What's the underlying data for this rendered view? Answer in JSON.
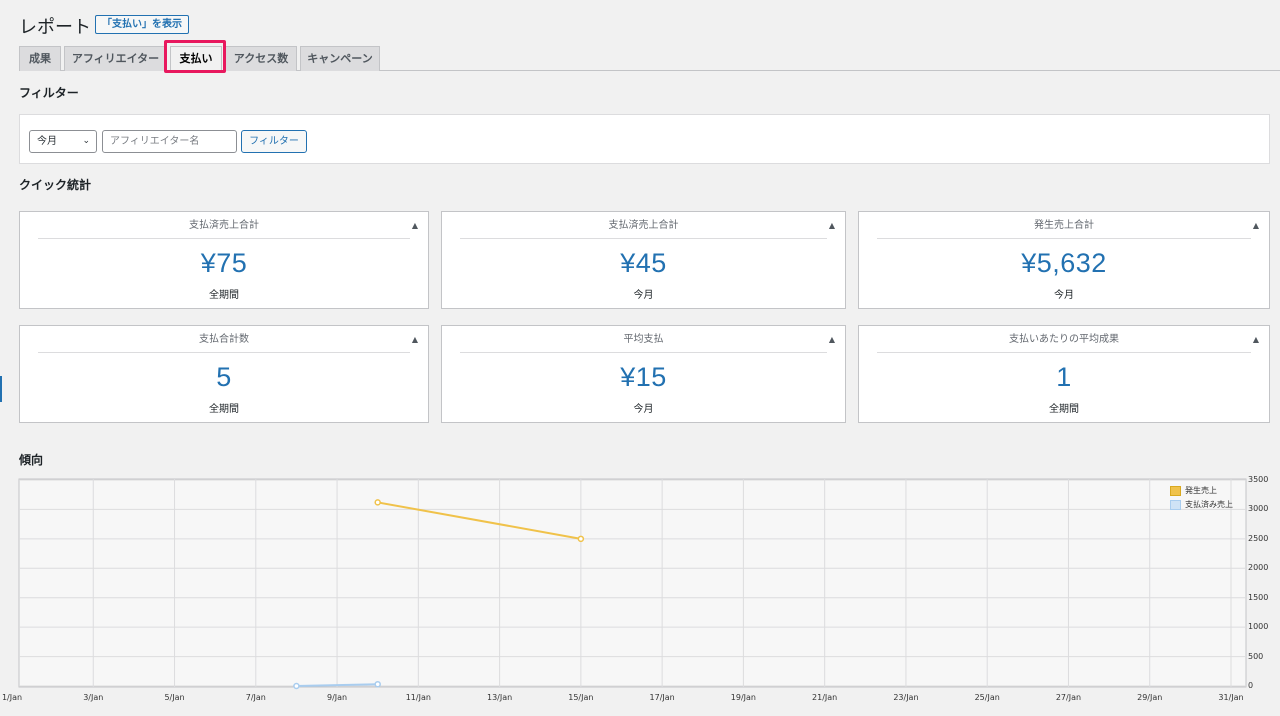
{
  "header": {
    "title": "レポート",
    "show_payouts_button": "「支払い」を表示"
  },
  "tabs": [
    {
      "label": "成果",
      "active": false
    },
    {
      "label": "アフィリエイター",
      "active": false
    },
    {
      "label": "支払い",
      "active": true
    },
    {
      "label": "アクセス数",
      "active": false
    },
    {
      "label": "キャンペーン",
      "active": false
    }
  ],
  "filter": {
    "heading": "フィルター",
    "period_select": "今月",
    "affiliate_placeholder": "アフィリエイター名",
    "filter_button": "フィルター"
  },
  "quick_stats": {
    "heading": "クイック統計",
    "cards": [
      {
        "title": "支払済売上合計",
        "value": "¥75",
        "period": "全期間"
      },
      {
        "title": "支払済売上合計",
        "value": "¥45",
        "period": "今月"
      },
      {
        "title": "発生売上合計",
        "value": "¥5,632",
        "period": "今月"
      },
      {
        "title": "支払合計数",
        "value": "5",
        "period": "全期間"
      },
      {
        "title": "平均支払",
        "value": "¥15",
        "period": "今月"
      },
      {
        "title": "支払いあたりの平均成果",
        "value": "1",
        "period": "全期間"
      }
    ]
  },
  "trend": {
    "heading": "傾向"
  },
  "colors": {
    "accent": "#2271b1",
    "highlight": "#e8185e",
    "series_generated": "#f0c24a",
    "series_paid": "#a9cdef"
  },
  "chart_data": {
    "type": "line",
    "x_ticks": [
      "1/Jan",
      "3/Jan",
      "5/Jan",
      "7/Jan",
      "9/Jan",
      "11/Jan",
      "13/Jan",
      "15/Jan",
      "17/Jan",
      "19/Jan",
      "21/Jan",
      "23/Jan",
      "25/Jan",
      "27/Jan",
      "29/Jan",
      "31/Jan"
    ],
    "xlim": [
      1,
      31
    ],
    "ylim": [
      0,
      3500
    ],
    "y_ticks": [
      0,
      500,
      1000,
      1500,
      2000,
      2500,
      3000,
      3500
    ],
    "y_axis_side": "right",
    "grid": true,
    "legend_position": "top-right",
    "series": [
      {
        "name": "発生売上",
        "color": "#f0c24a",
        "points": [
          {
            "x": 10,
            "y": 3120
          },
          {
            "x": 15,
            "y": 2500
          }
        ]
      },
      {
        "name": "支払済み売上",
        "color": "#a9cdef",
        "points": [
          {
            "x": 8,
            "y": 0
          },
          {
            "x": 10,
            "y": 30
          }
        ]
      }
    ]
  }
}
